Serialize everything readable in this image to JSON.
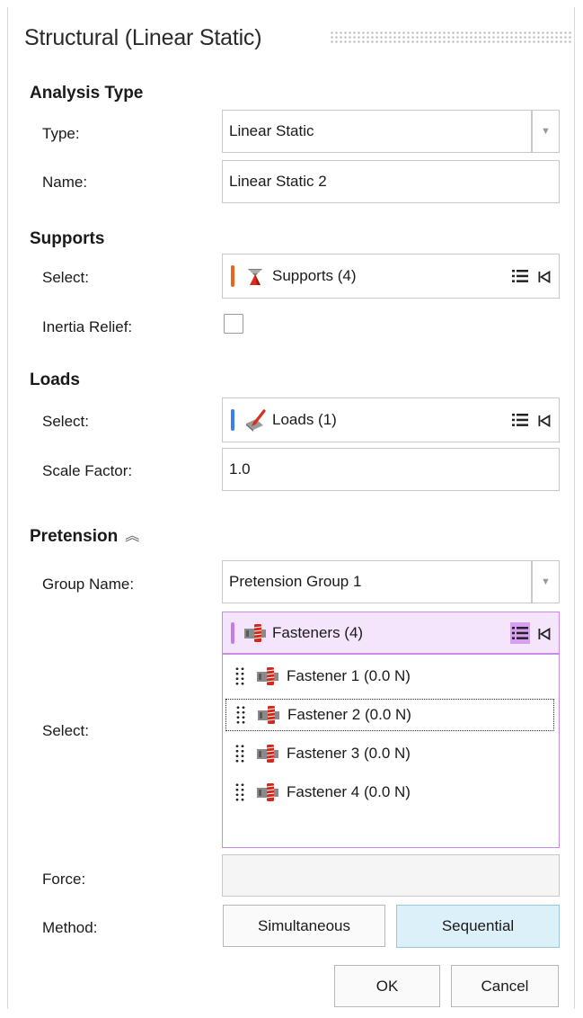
{
  "window": {
    "title": "Structural (Linear Static)"
  },
  "analysis_type": {
    "heading": "Analysis Type",
    "type_label": "Type:",
    "type_value": "Linear Static",
    "name_label": "Name:",
    "name_value": "Linear Static 2"
  },
  "supports": {
    "heading": "Supports",
    "select_label": "Select:",
    "selector_text": "Supports (4)",
    "selector_color": "#e8651a",
    "inertia_label": "Inertia Relief:",
    "inertia_checked": false
  },
  "loads": {
    "heading": "Loads",
    "select_label": "Select:",
    "selector_text": "Loads (1)",
    "selector_color": "#3a7ff0",
    "scale_label": "Scale Factor:",
    "scale_value": "1.0"
  },
  "pretension": {
    "heading": "Pretension",
    "group_label": "Group Name:",
    "group_value": "Pretension Group 1",
    "select_label": "Select:",
    "selector_text": "Fasteners (4)",
    "selector_color": "#c77be8",
    "items": [
      {
        "label": "Fastener 1 (0.0 N)"
      },
      {
        "label": "Fastener 2 (0.0 N)"
      },
      {
        "label": "Fastener 3 (0.0 N)"
      },
      {
        "label": "Fastener 4 (0.0 N)"
      }
    ],
    "force_label": "Force:",
    "force_value": "",
    "method_label": "Method:",
    "method_simultaneous": "Simultaneous",
    "method_sequential": "Sequential",
    "method_selected": "Sequential"
  },
  "actions": {
    "ok_label": "OK",
    "cancel_label": "Cancel"
  }
}
